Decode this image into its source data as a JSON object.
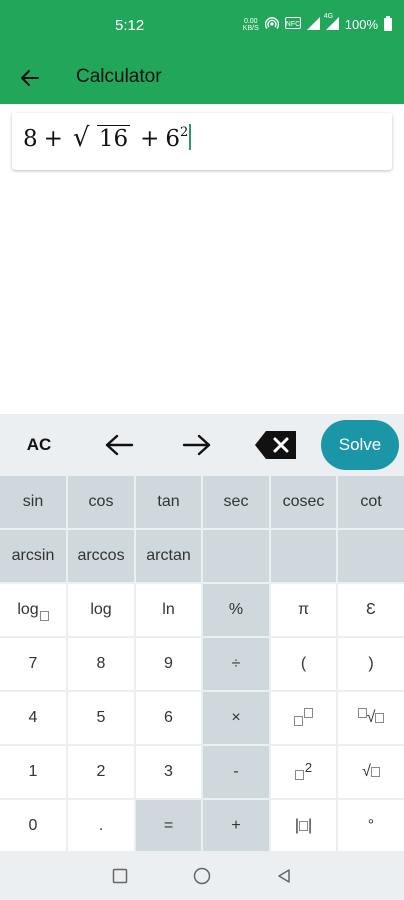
{
  "status_bar": {
    "time": "5:12",
    "data_speed_top": "0.00",
    "data_speed_bottom": "KB/S",
    "lte_label": "4G",
    "battery_percent": "100%"
  },
  "app_bar": {
    "title": "Calculator"
  },
  "expression": {
    "a": "8",
    "plus1": "+",
    "radicand": "16",
    "plus2": "+",
    "base": "6",
    "exponent": "2"
  },
  "controls": {
    "ac": "AC",
    "solve": "Solve"
  },
  "keys": {
    "sin": "sin",
    "cos": "cos",
    "tan": "tan",
    "sec": "sec",
    "cosec": "cosec",
    "cot": "cot",
    "arcsin": "arcsin",
    "arccos": "arccos",
    "arctan": "arctan",
    "log_base": "log",
    "log": "log",
    "ln": "ln",
    "percent": "%",
    "pi": "π",
    "euler": "Ɛ",
    "seven": "7",
    "eight": "8",
    "nine": "9",
    "divide": "÷",
    "lparen": "(",
    "rparen": ")",
    "four": "4",
    "five": "5",
    "six": "6",
    "multiply": "×",
    "one": "1",
    "two": "2",
    "three": "3",
    "minus": "-",
    "square_exp": "2",
    "zero": "0",
    "dot": ".",
    "equals": "=",
    "plus": "+",
    "degree": "°"
  },
  "icons": {
    "back": "arrow-left-icon",
    "cursor_left": "arrow-left-icon",
    "cursor_right": "arrow-right-icon",
    "backspace": "backspace-icon",
    "nav_recents": "square-icon",
    "nav_home": "circle-icon",
    "nav_back": "triangle-icon"
  },
  "colors": {
    "app_bar": "#22a659",
    "solve_button": "#1b96a7",
    "function_key": "#cfd8dc",
    "caret": "#2e9a63"
  }
}
